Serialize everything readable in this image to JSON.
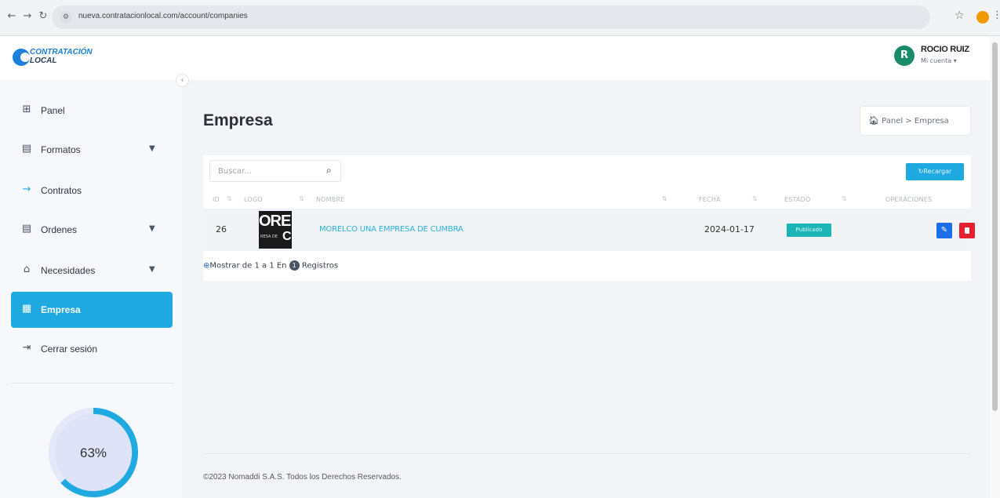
{
  "browser": {
    "url": "nueva.contratacionlocal.com/account/companies",
    "profile_initial": "R"
  },
  "brand": {
    "line1": "CONTRATACIÓN",
    "line2": "LOCAL",
    "accent": "#1fa9e1"
  },
  "user": {
    "initial": "R",
    "name": "ROCIO RUIZ",
    "account_label": "Mi cuenta"
  },
  "sidebar": {
    "items": [
      {
        "label": "Panel",
        "icon": "grid-icon"
      },
      {
        "label": "Formatos",
        "icon": "clipboard-icon",
        "has_submenu": true
      },
      {
        "label": "Contratos",
        "icon": "arrow-right-icon"
      },
      {
        "label": "Ordenes",
        "icon": "clipboard-icon",
        "has_submenu": true
      },
      {
        "label": "Necesidades",
        "icon": "inbox-icon",
        "has_submenu": true
      },
      {
        "label": "Empresa",
        "icon": "building-icon",
        "active": true
      },
      {
        "label": "Cerrar sesión",
        "icon": "logout-icon"
      }
    ],
    "progress_label": "63%",
    "progress_value": 0.63
  },
  "page": {
    "title": "Empresa",
    "breadcrumb": {
      "home": "Panel",
      "separator": ">",
      "current": "Empresa"
    }
  },
  "table": {
    "search_placeholder": "Buscar...",
    "reload_label": "Recargar",
    "headers": [
      "ID",
      "LOGO",
      "NOMBRE",
      "FECHA",
      "ESTADO",
      "OPERACIONES"
    ],
    "rows": [
      {
        "id": "26",
        "logo_text_big": "ORE",
        "logo_text_small": "RESA DE",
        "logo_text_c": "C",
        "nombre": "MORELCO UNA EMPRESA DE CUMBRA",
        "fecha": "2024-01-17",
        "estado": "Publicado"
      }
    ],
    "pagination": {
      "prefix": "Mostrar de 1 a 1 En",
      "count": "1",
      "suffix": "Registros"
    }
  },
  "footer": {
    "text": "©2023 Nomaddi S.A.S. Todos los Derechos Reservados."
  }
}
